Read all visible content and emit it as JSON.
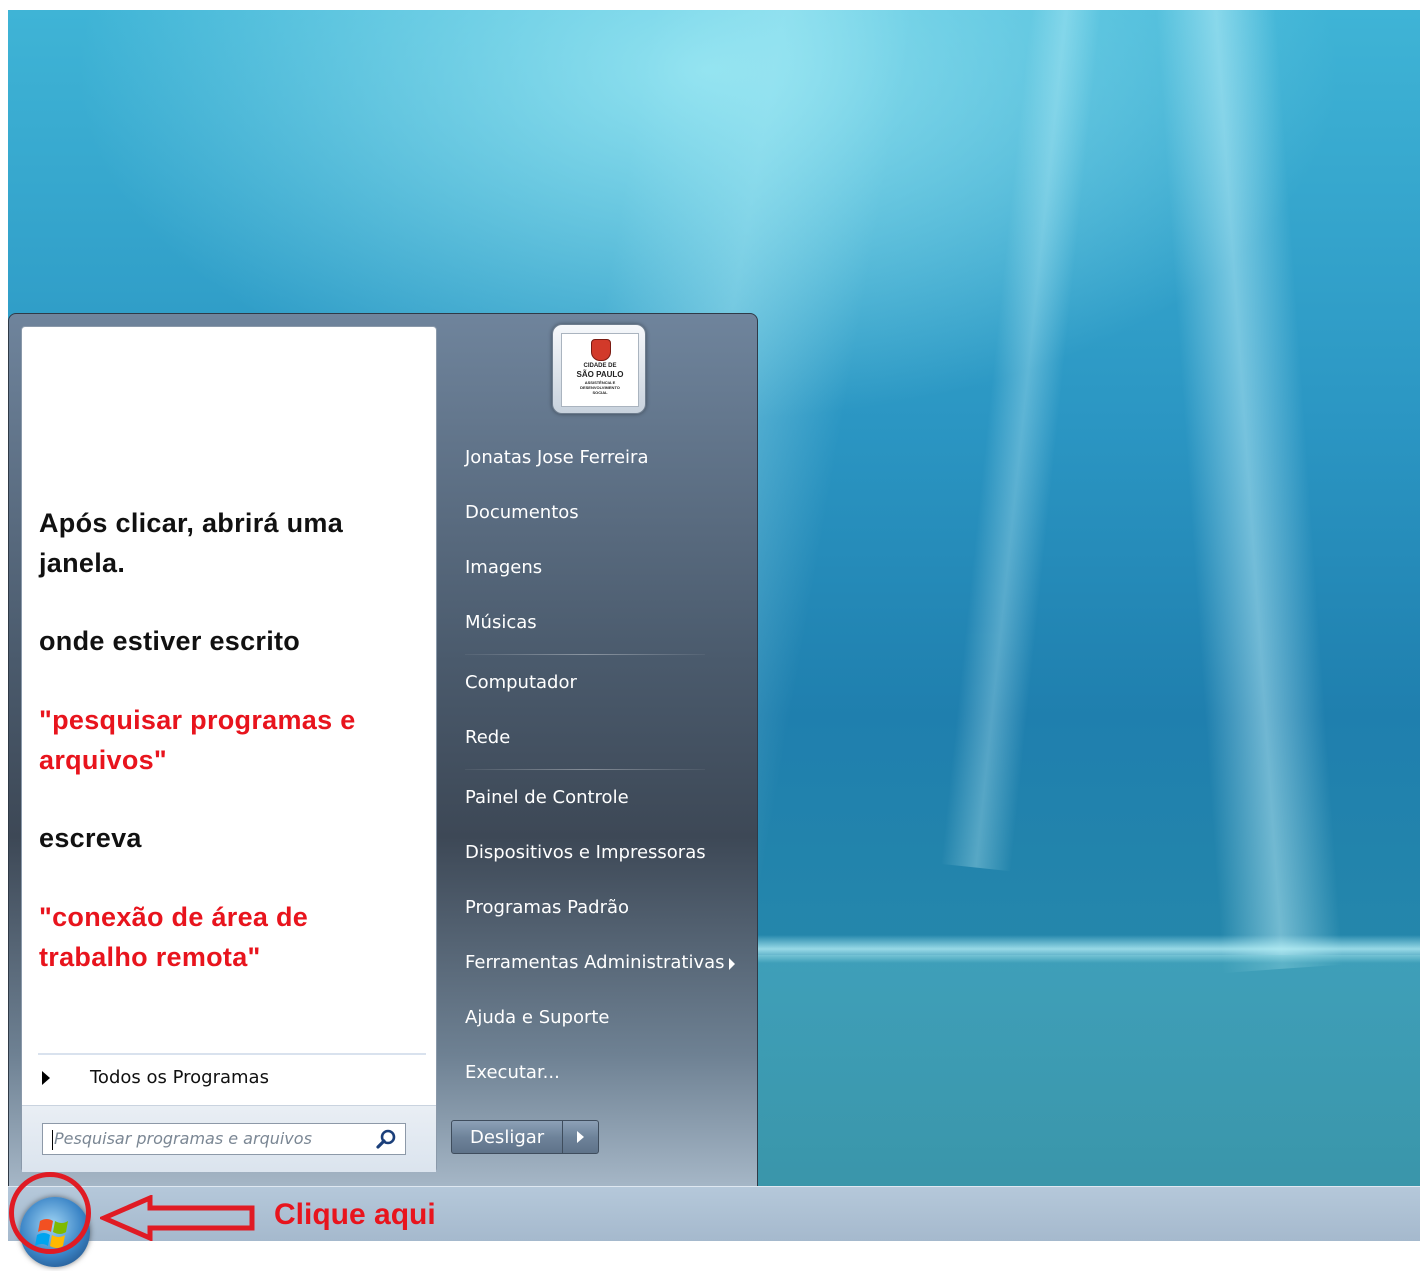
{
  "instructions": {
    "line1": "Após clicar, abrirá uma",
    "line2": "janela.",
    "line3": "onde estiver escrito",
    "line4": "\"pesquisar programas e",
    "line5": "arquivos\"",
    "line6": "escreva",
    "line7": "\"conexão de área de",
    "line8": "trabalho remota\""
  },
  "start_menu": {
    "all_programs": "Todos os Programas",
    "search_placeholder": "Pesquisar programas e arquivos",
    "avatar_text": [
      "CIDADE DE",
      "SÃO PAULO",
      "ASSISTÊNCIA E",
      "DESENVOLVIMENTO",
      "SOCIAL"
    ],
    "right_items": [
      "Jonatas Jose Ferreira",
      "Documentos",
      "Imagens",
      "Músicas",
      "Computador",
      "Rede",
      "Painel de Controle",
      "Dispositivos e Impressoras",
      "Programas Padrão",
      "Ferramentas Administrativas",
      "Ajuda e Suporte",
      "Executar..."
    ],
    "shutdown_label": "Desligar"
  },
  "annotation": {
    "click_here": "Clique aqui",
    "color": "#e8141d"
  }
}
